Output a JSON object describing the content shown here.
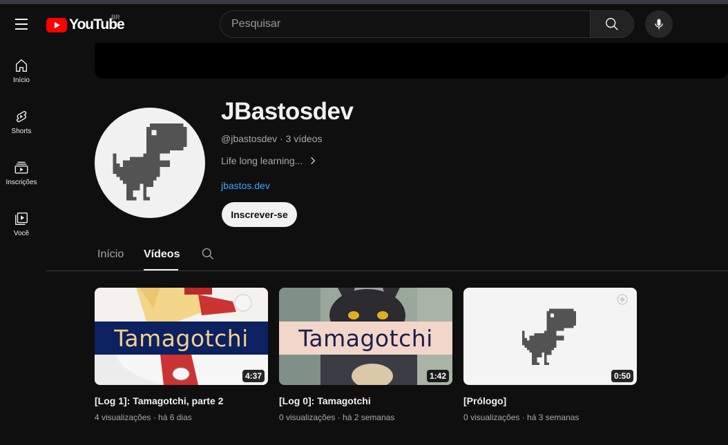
{
  "header": {
    "logo_text": "YouTube",
    "region": "BR",
    "search_placeholder": "Pesquisar"
  },
  "sidebar": {
    "items": [
      {
        "label": "Início",
        "icon": "home-icon"
      },
      {
        "label": "Shorts",
        "icon": "shorts-icon"
      },
      {
        "label": "Inscrições",
        "icon": "subscriptions-icon"
      },
      {
        "label": "Você",
        "icon": "you-icon"
      }
    ]
  },
  "channel": {
    "name": "JBastosdev",
    "meta": "@jbastosdev · 3 vídeos",
    "description": "Life long learning...",
    "link": "jbastos.dev",
    "subscribe_label": "Inscrever-se"
  },
  "tabs": {
    "home": "Início",
    "videos": "Vídeos"
  },
  "videos": [
    {
      "title": "[Log 1]: Tamagotchi, parte 2",
      "meta": "4 visualizações · há 6 dias",
      "duration": "4:37",
      "thumb_text": "Tamagotchi"
    },
    {
      "title": "[Log 0]: Tamagotchi",
      "meta": "0 visualizações · há 2 semanas",
      "duration": "1:42",
      "thumb_text": "Tamagotchi"
    },
    {
      "title": "[Prólogo]",
      "meta": "0 visualizações · há 3 semanas",
      "duration": "0:50"
    }
  ],
  "colors": {
    "background": "#0f0f0f",
    "link": "#3ea6ff",
    "youtube_red": "#ff0000"
  }
}
